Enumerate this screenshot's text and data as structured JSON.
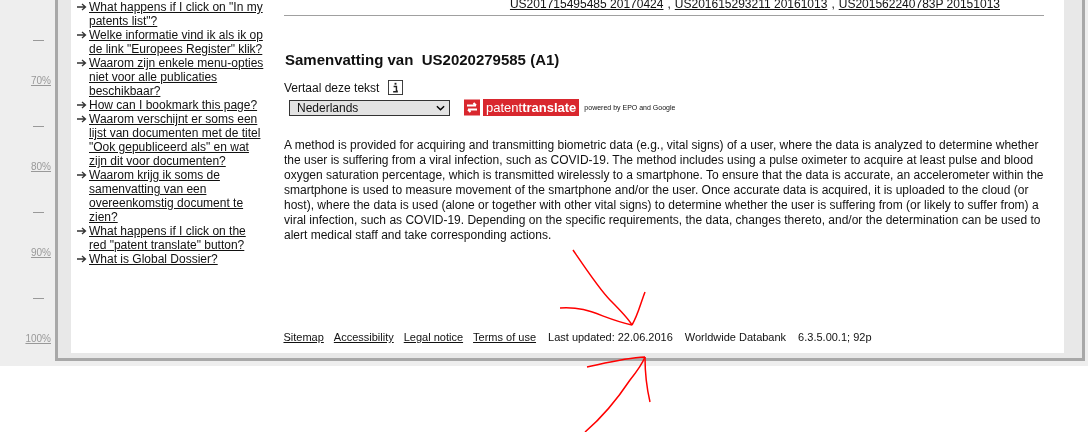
{
  "ruler": {
    "labels": [
      "70%",
      "80%",
      "90%",
      "100%"
    ]
  },
  "faq_links": [
    "What happens if I click on \"In my patents list\"?",
    "Welke informatie vind ik als ik op de link \"Europees Register\" klik?",
    "Waarom zijn enkele menu-opties niet voor alle publicaties beschikbaar?",
    "How can I bookmark this page?",
    "Waarom verschijnt er soms een lijst van documenten met de titel \"Ook gepubliceerd als\" en wat zijn dit voor documenten?",
    "Waarom krijg ik soms de samenvatting van een overeenkomstig document te zien?",
    "What happens if I click on the red \"patent translate\" button?",
    "What is Global Dossier?"
  ],
  "related_documents": [
    {
      "text": "US201715495485 20170424",
      "separator": ","
    },
    {
      "text": "US201615293211 20161013",
      "separator": ","
    },
    {
      "text": "US201562240783P 20151013"
    }
  ],
  "abstract": {
    "title": "Samenvatting van  US2020279585 (A1)",
    "translate_label": "Vertaal deze tekst",
    "language": "Nederlands",
    "logo": {
      "part_1": "patent",
      "part_2": "translate"
    },
    "powered_by": "powered by EPO and Google",
    "text": "A method is provided for acquiring and transmitting biometric data (e.g., vital signs) of a user, where the data is analyzed to determine whether the user is suffering from a viral infection, such as COVID-19. The method includes using a pulse oximeter to acquire at least pulse and blood oxygen saturation percentage, which is transmitted wirelessly to a smartphone. To ensure that the data is accurate, an accelerometer within the smartphone is used to measure movement of the smartphone and/or the user. Once accurate data is acquired, it is uploaded to the cloud (or host), where the data is used (alone or together with other vital signs) to determine whether the user is suffering from (or likely to suffer from) a viral infection, such as COVID-19. Depending on the specific requirements, the data, changes thereto, and/or the determination can be used to alert medical staff and take corresponding actions."
  },
  "footer": {
    "links": [
      "Sitemap",
      "Accessibility",
      "Legal notice",
      "Terms of use"
    ],
    "texts": [
      "Last updated: 22.06.2016",
      "Worldwide Databank",
      "6.3.5.00.1; 92p"
    ]
  }
}
